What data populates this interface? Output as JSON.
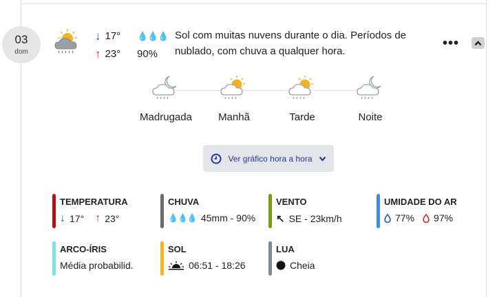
{
  "day": {
    "number": "03",
    "name": "dom"
  },
  "summary": {
    "icon": "partly-cloudy-rain-icon",
    "min_temp": "17°",
    "max_temp": "23°",
    "rain_chance": "90%",
    "description": "Sol com muitas nuvens durante o dia. Períodos de nublado, com chuva a qualquer hora."
  },
  "periods": [
    {
      "label": "Madrugada",
      "icon": "night-cloud-rain-icon"
    },
    {
      "label": "Manhã",
      "icon": "sun-cloud-rain-icon"
    },
    {
      "label": "Tarde",
      "icon": "sun-cloud-rain-icon"
    },
    {
      "label": "Noite",
      "icon": "night-cloud-rain-icon"
    }
  ],
  "hourly_button": {
    "label": "Ver gráfico hora a hora"
  },
  "stats": {
    "temperature": {
      "title": "TEMPERATURA",
      "min": "17°",
      "max": "23°",
      "color": "#b5121b"
    },
    "rain": {
      "title": "CHUVA",
      "value": "45mm - 90%",
      "color": "#6b6b6b"
    },
    "wind": {
      "title": "VENTO",
      "value": "SE - 23km/h",
      "color": "#7a9a1a"
    },
    "humidity": {
      "title": "UMIDADE DO AR",
      "min": "77%",
      "max": "97%",
      "color": "#3d8ee8"
    },
    "rainbow": {
      "title": "ARCO-ÍRIS",
      "value": "Média probabilid.",
      "color": "#7ee0e0"
    },
    "sun": {
      "title": "SOL",
      "value": "06:51 - 18:26",
      "color": "#f5b623"
    },
    "moon": {
      "title": "LUA",
      "value": "Cheia",
      "color": "#7b8a94"
    }
  }
}
